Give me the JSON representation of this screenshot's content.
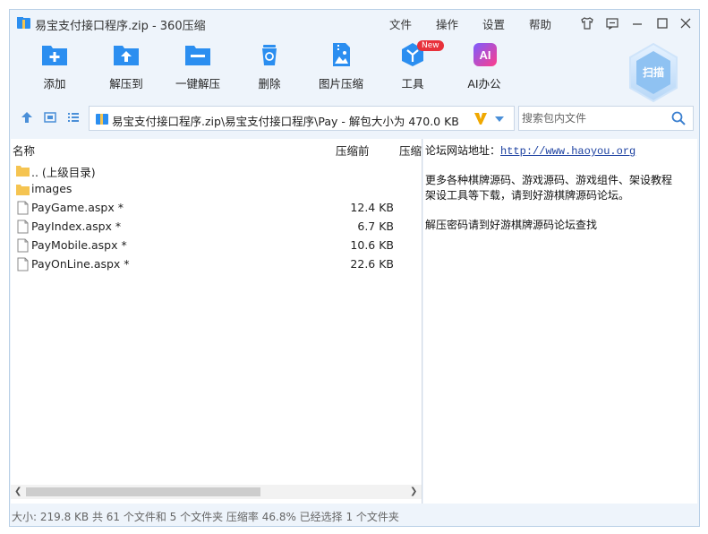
{
  "window": {
    "title": "易宝支付接口程序.zip - 360压缩"
  },
  "menu": {
    "file": "文件",
    "operation": "操作",
    "settings": "设置",
    "help": "帮助"
  },
  "toolbar": {
    "add": "添加",
    "extract_to": "解压到",
    "one_click": "一键解压",
    "delete": "删除",
    "image_compress": "图片压缩",
    "tools": "工具",
    "new_badge": "New",
    "ai_office": "AI办公",
    "ai_icon_text": "AI",
    "scan": "扫描"
  },
  "address": {
    "path": "易宝支付接口程序.zip\\易宝支付接口程序\\Pay - 解包大小为 470.0 KB"
  },
  "search": {
    "placeholder": "搜索包内文件"
  },
  "file_list": {
    "columns": {
      "name": "名称",
      "before": "压缩前",
      "after": "压缩"
    },
    "rows": [
      {
        "name": ".. (上级目录)",
        "size": "",
        "type": "folder"
      },
      {
        "name": "images",
        "size": "",
        "type": "folder"
      },
      {
        "name": "PayGame.aspx *",
        "size": "12.4 KB",
        "type": "file"
      },
      {
        "name": "PayIndex.aspx *",
        "size": "6.7 KB",
        "type": "file"
      },
      {
        "name": "PayMobile.aspx *",
        "size": "10.6 KB",
        "type": "file"
      },
      {
        "name": "PayOnLine.aspx *",
        "size": "22.6 KB",
        "type": "file"
      }
    ]
  },
  "comment": {
    "line1_label": "论坛网站地址：",
    "line1_link": "http://www.haoyou.org",
    "line2": "更多各种棋牌源码、游戏源码、游戏组件、架设教程",
    "line3": "架设工具等下载，请到好游棋牌源码论坛。",
    "line4": "解压密码请到好游棋牌源码论坛查找"
  },
  "status": {
    "text": "大小: 219.8 KB 共 61 个文件和 5 个文件夹 压缩率 46.8% 已经选择 1 个文件夹"
  },
  "colors": {
    "accent": "#2b8ef0",
    "window_bg": "#eef4fb",
    "folder": "#f5c451"
  }
}
